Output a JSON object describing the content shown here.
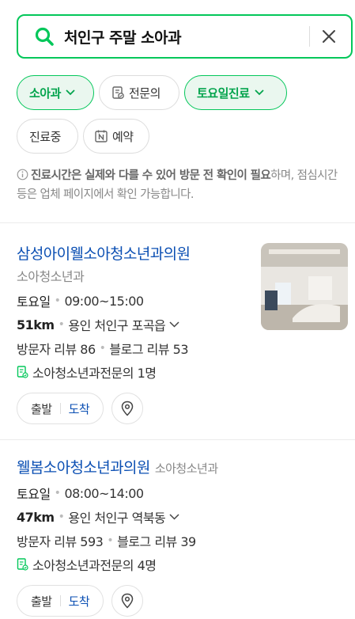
{
  "search": {
    "query": "처인구 주말 소아과"
  },
  "filters": [
    {
      "label": "소아과"
    },
    {
      "label": "전문의"
    },
    {
      "label": "토요일진료"
    },
    {
      "label": "진료중"
    },
    {
      "label": "예약"
    }
  ],
  "notice": {
    "bold_part": "진료시간은 실제와 다를 수 있어 방문 전 확인이 필요",
    "rest": "하며, 점심시간 등은 업체 페이지에서 확인 가능합니다."
  },
  "results": [
    {
      "name": "삼성아이웰소아청소년과의원",
      "category": "소아청소년과",
      "day": "토요일",
      "hours": "09:00~15:00",
      "distance": "51km",
      "address": "용인 처인구 포곡읍",
      "visitor_reviews": "방문자 리뷰 86",
      "blog_reviews": "블로그 리뷰 53",
      "specialists": "소아청소년과전문의 1명",
      "depart_label": "출발",
      "arrive_label": "도착"
    },
    {
      "name": "웰봄소아청소년과의원",
      "category": "소아청소년과",
      "day": "토요일",
      "hours": "08:00~14:00",
      "distance": "47km",
      "address": "용인 처인구 역북동",
      "visitor_reviews": "방문자 리뷰 593",
      "blog_reviews": "블로그 리뷰 39",
      "specialists": "소아청소년과전문의 4명",
      "depart_label": "출발",
      "arrive_label": "도착"
    }
  ],
  "colors": {
    "accent": "#03c75a",
    "link": "#0b4fb3"
  }
}
